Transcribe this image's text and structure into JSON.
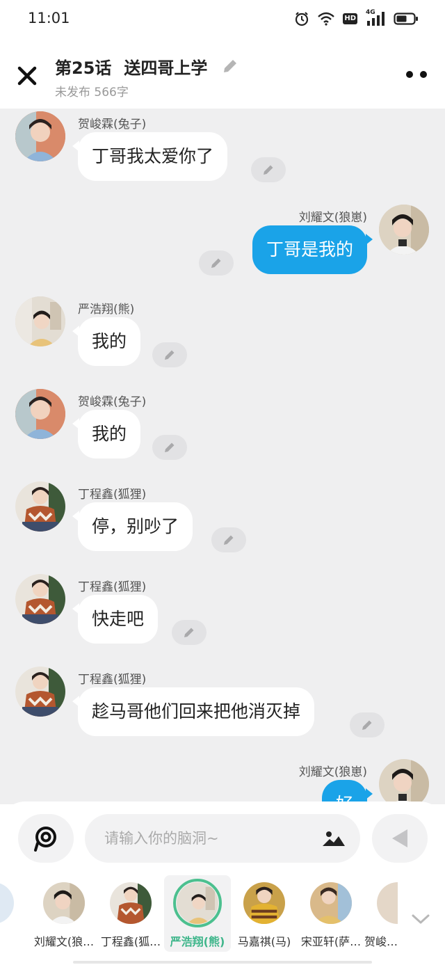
{
  "status_bar": {
    "time": "11:01",
    "icons": [
      "alarm-icon",
      "wifi-icon",
      "hd-badge",
      "signal-4g-icon",
      "battery-icon"
    ],
    "hd_label": "HD",
    "network_label": "4G"
  },
  "header": {
    "chapter": "第25话",
    "title": "送四哥上学",
    "subtitle": "未发布 566字"
  },
  "messages": [
    {
      "side": "left",
      "sender": "贺峻霖(兔子)",
      "text": "丁哥我太爱你了"
    },
    {
      "side": "right",
      "sender": "刘耀文(狼崽)",
      "text": "丁哥是我的"
    },
    {
      "side": "left",
      "sender": "严浩翔(熊)",
      "text": "我的"
    },
    {
      "side": "left",
      "sender": "贺峻霖(兔子)",
      "text": "我的"
    },
    {
      "side": "left",
      "sender": "丁程鑫(狐狸)",
      "text": "停，别吵了"
    },
    {
      "side": "left",
      "sender": "丁程鑫(狐狸)",
      "text": "快走吧"
    },
    {
      "side": "left",
      "sender": "丁程鑫(狐狸)",
      "text": "趁马哥他们回来把他消灭掉"
    },
    {
      "side": "right",
      "sender": "刘耀文(狼崽)",
      "text": "好"
    }
  ],
  "input": {
    "placeholder": "请输入你的脑洞~"
  },
  "characters": [
    {
      "name": "刘耀文(狼…",
      "active": false
    },
    {
      "name": "丁程鑫(狐…",
      "active": false
    },
    {
      "name": "严浩翔(熊)",
      "active": true
    },
    {
      "name": "马嘉祺(马)",
      "active": false
    },
    {
      "name": "宋亚轩(萨…",
      "active": false
    },
    {
      "name": "贺峻…",
      "active": false
    }
  ],
  "colors": {
    "accent_blue": "#1aa3e8",
    "active_green": "#4cc08f",
    "chat_bg": "#efeff0"
  }
}
